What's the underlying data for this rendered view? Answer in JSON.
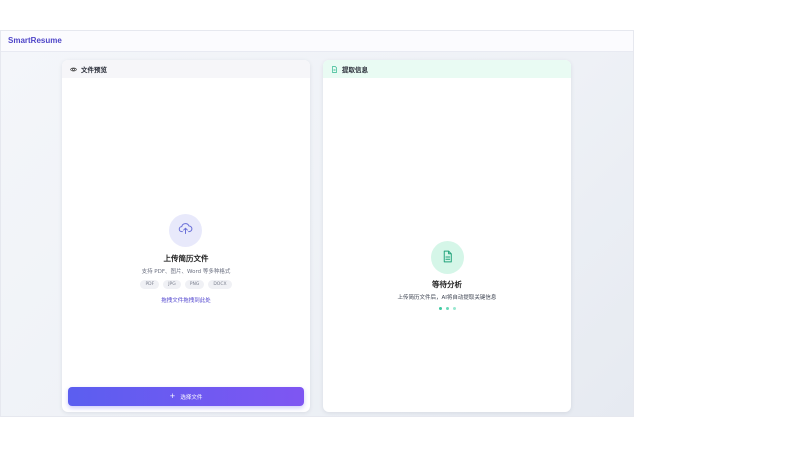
{
  "app": {
    "brand": "SmartResume"
  },
  "preview_panel": {
    "title": "文件预览",
    "icon": "eye-icon",
    "upload": {
      "icon": "cloud-upload-icon",
      "title": "上传简历文件",
      "description": "支持 PDF、图片、Word 等多种格式",
      "formats": [
        "PDF",
        "JPG",
        "PNG",
        "DOCX"
      ],
      "drag_hint": "拖拽文件拖拽到此处"
    },
    "select_button": {
      "icon": "plus-icon",
      "label": "选择文件"
    }
  },
  "extract_panel": {
    "title": "提取信息",
    "icon": "document-icon",
    "status": {
      "icon": "document-text-icon",
      "title": "等待分析",
      "description": "上传简历文件后，AI将自动提取关键信息"
    }
  },
  "colors": {
    "brand": "#4f46c8",
    "primary_gradient_start": "#5b5ef0",
    "primary_gradient_end": "#7f56f2",
    "success": "#3cc9a0"
  }
}
